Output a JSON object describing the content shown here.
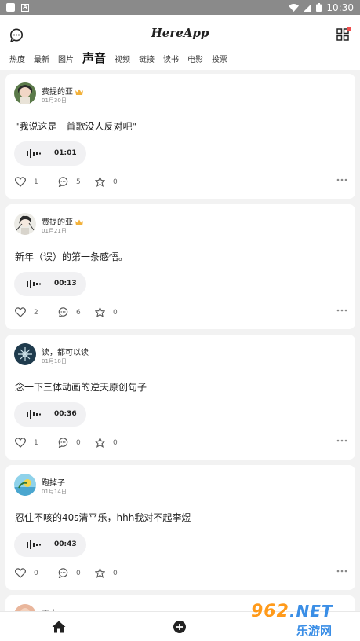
{
  "status_bar": {
    "time": "10:30",
    "badge_letter": "A"
  },
  "header": {
    "logo": "HereApp",
    "tabs": [
      {
        "label": "热度",
        "active": false
      },
      {
        "label": "最新",
        "active": false
      },
      {
        "label": "图片",
        "active": false
      },
      {
        "label": "声音",
        "active": true
      },
      {
        "label": "视频",
        "active": false
      },
      {
        "label": "链接",
        "active": false
      },
      {
        "label": "读书",
        "active": false
      },
      {
        "label": "电影",
        "active": false
      },
      {
        "label": "投票",
        "active": false
      }
    ]
  },
  "posts": [
    {
      "username": "费提的亚",
      "crown": true,
      "date": "01月30日",
      "text": "\"我说这是一首歌没人反对吧\"",
      "duration": "01:01",
      "likes": "1",
      "comments": "5",
      "favorites": "0"
    },
    {
      "username": "费提的亚",
      "crown": true,
      "date": "01月21日",
      "text": "新年（误）的第一条感悟。",
      "duration": "00:13",
      "likes": "2",
      "comments": "6",
      "favorites": "0"
    },
    {
      "username": "读，都可以读",
      "crown": false,
      "date": "01月18日",
      "text": "念一下三体动画的逆天原创句子",
      "duration": "00:36",
      "likes": "1",
      "comments": "0",
      "favorites": "0"
    },
    {
      "username": "跑掉子",
      "crown": false,
      "date": "01月14日",
      "text": "忍住不咳的40s清平乐，hhh我对不起李煜",
      "duration": "00:43",
      "likes": "0",
      "comments": "0",
      "favorites": "0"
    }
  ],
  "peek_post": {
    "username": "工人"
  },
  "watermark": {
    "brand": "962",
    "suffix": ".NET",
    "site": "乐游网"
  },
  "colors": {
    "accent": "#ef4c4c",
    "crown": "#f2b13a",
    "watermark_orange": "#ff9a1a",
    "watermark_blue": "#3a8ee6"
  }
}
